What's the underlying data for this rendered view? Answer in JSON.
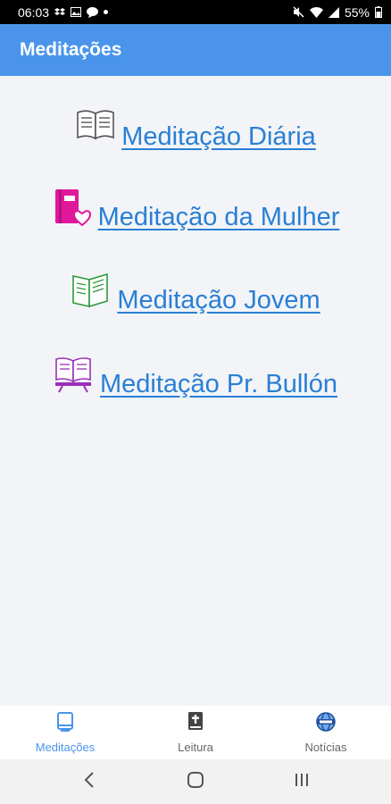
{
  "status_bar": {
    "time": "06:03",
    "battery": "55%"
  },
  "app_bar": {
    "title": "Meditações"
  },
  "links": [
    {
      "label": "Meditação Diária",
      "icon": "open-book-icon",
      "color": "#555555"
    },
    {
      "label": "Meditação da Mulher",
      "icon": "pink-book-heart-icon",
      "color": "#e0189b"
    },
    {
      "label": "Meditação Jovem",
      "icon": "green-open-book-icon",
      "color": "#2e9a3a"
    },
    {
      "label": "Meditação Pr. Bullón",
      "icon": "purple-book-stand-icon",
      "color": "#9b2fb8"
    }
  ],
  "bottom_nav": {
    "items": [
      {
        "label": "Meditações",
        "icon": "book-icon",
        "active": true
      },
      {
        "label": "Leitura",
        "icon": "bible-icon",
        "active": false
      },
      {
        "label": "Notícias",
        "icon": "globe-icon",
        "active": false
      }
    ]
  },
  "colors": {
    "primary": "#4a95eb",
    "link": "#2a7fd4",
    "background": "#f2f4f8"
  }
}
